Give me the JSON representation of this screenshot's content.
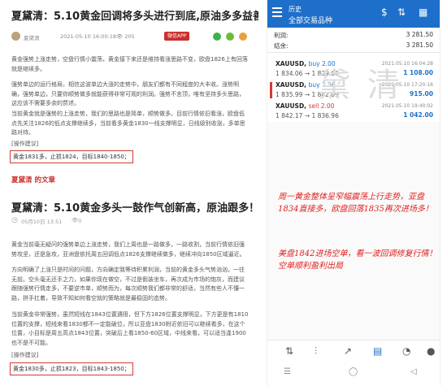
{
  "article1": {
    "title": "夏黛清：5.10黄金回调将多头进行到底,原油多多益善!",
    "author": "夏黛清",
    "date": "2021-05-10 16:00:18",
    "views": "205",
    "app_label": "微信APP",
    "paragraphs": [
      "黄金强势上涨走势，空盘行情小震荡，黄金接下来还是维持看涨思路不变，欧盘1826上有回落就是继续多。",
      "强势单边的运行格局，相信这波单边大涨的走势中，朋友们都有不同程度的大丰收。涨势明确，强势单边，只要你顺势做多就能获得非常可观的利润。强势不言顶，唯有坚持多头思路，这应该不需要多余的赘述。",
      "当前黄金就是强势的上涨走势，我们的思路也是简单，顺势做多。目前行情依旧看涨，欧盘低点先关注1826的低点支撑继续多，当前看多黄金1830一线支撑明显，日线级别收涨，多单思路对待。"
    ],
    "ops_label": "[操作建议]",
    "advice": "黄金1831多，止损1824，目标1840-1850；"
  },
  "section_head": "夏黛清 的文章",
  "article2": {
    "title": "夏黛清：5.10黄金多头一鼓作气创新高，原油跟多！",
    "date": "05月10日 13:51",
    "views": "0",
    "paragraphs": [
      "黄金当前毫无疑问的强势单边上涨走势，我们上周也是一路做多，一路收割，当前行情依旧强势攻坚，还是急攻，亚洲盘依托周五回调低点1826支撑继续做多，继续冲向1850区域逼近。",
      "方向明确了上涨只是时间的问题，方向确定我等待积累利润，当前的黄金多头气势汹汹，一往无前。空头毫无还手之力，如果你现在做空，不过是假装坐车，再次成为市场的炮灰，而建议跟随强势行情走多，不要逆市单，顺势而为，每次顺势我们都非常的舒适，当然有些人不懂一路，拼手扛着，导致不知如何看空就的策略就是最稳固的态势。",
      "当前黄金非常强势，虽然短线在1843位置遇阻，但下方1826位置支撑明显，下方更是有1810位置的支撑，短线来看1830都不一定能破位，所以亚盘1830附近依旧可以继续看多，在这个位置，小目标是周五高点1843位置，突破后上看1850-60区域，中线来看，可以适当逢1900也不是不可能。"
    ],
    "ops_label": "[操作建议]",
    "advice": "黄金1830多，止损1823，目标1843-1850；"
  },
  "app": {
    "title_small": "历史",
    "title_main": "全部交易品种",
    "profit_label": "利润:",
    "profit_value": "3 281.50",
    "balance_label": "结余:",
    "balance_value": "3 281.50",
    "orders": [
      {
        "symbol": "XAUUSD,",
        "side": "buy 2.00",
        "prices": "1 834.06 → 1 839.60",
        "time": "2021.05.10 16:04:28",
        "pl": "1 108.00"
      },
      {
        "symbol": "XAUUSD,",
        "side": "buy 1.50",
        "prices": "1 835.99 → 1 842.09",
        "time": "2021.05.10 17:20:16",
        "pl": "915.00"
      },
      {
        "symbol": "XAUUSD,",
        "side": "sell 2.00",
        "prices": "1 842.17 → 1 836.96",
        "time": "2021.05.10 19:40:02",
        "pl": "1 042.00"
      }
    ],
    "watermark": "黛 清"
  },
  "notes": [
    "周一黄金整体呈窄幅震荡上行走势，亚盘1834直接多，欧盘回落1835再次进场多！",
    "美盘1842进场空单，看一波回调修复行情！空单顺利盈利出局"
  ]
}
